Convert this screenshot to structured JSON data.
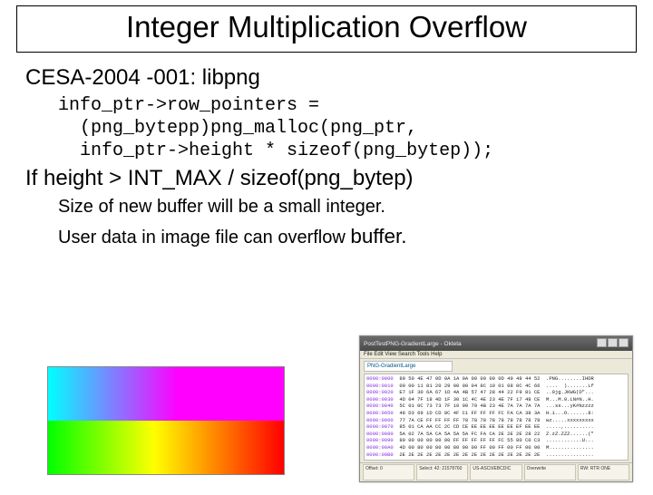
{
  "title": "Integer Multiplication Overflow",
  "advisory": "CESA-2004 -001: libpng",
  "code": "info_ptr->row_pointers =\n  (png_bytepp)png_malloc(png_ptr,\n  info_ptr->height * sizeof(png_bytep));",
  "condition": "If height > INT_MAX / sizeof(png_bytep)",
  "consequence_1": "Size of new buffer will be a small integer.",
  "consequence_2_a": "User data in image file can overflow ",
  "consequence_2_b": "buffer.",
  "hexview": {
    "window_title": "PostTestPNG-GradientLarge - Okteta",
    "menu": "File  Edit  View  Search  Tools  Help",
    "tab": "PNG-GradientLarge",
    "lines": [
      {
        "addr": "0000:0000",
        "hex": "89 50 4E 47 0D 0A 1A 0A 00 00 00 0D 49 48 44 52",
        "asc": ".PNG........IHDR"
      },
      {
        "addr": "0000:0010",
        "hex": "00 00 11 81 20 29 00 00 04 8C 10 01 08 0C 4C 66",
        "asc": "....  ).......Lf"
      },
      {
        "addr": "0000:0020",
        "hex": "E7 1F 30 6A 67 1D 4A 4B 57 47 28 44 22 F9 81 CE",
        "asc": "..0jg.JKWG(D\"..."
      },
      {
        "addr": "0000:0030",
        "hex": "4D 04 7F 18 4D 1F 30 1C 4C 4E 23 4E 7F 17 48 CE",
        "asc": "M...M.0.LN#N..H."
      },
      {
        "addr": "0000:0040",
        "hex": "5C 01 0C 73 73 7F 10 00 79 4B 23 4E 7A 7A 7A 7A",
        "asc": "...ss...yK#Nzzzz"
      },
      {
        "addr": "0000:0050",
        "hex": "48 D3 69 1D CD 8C 4F C1 FF FF FF FC FA CA 38 3A",
        "asc": "H.i...O.......8:"
      },
      {
        "addr": "0000:0060",
        "hex": "77 7A CE FF FF FF FF 78 78 78 78 78 78 78 78 78",
        "asc": "wz.....xxxxxxxxx"
      },
      {
        "addr": "0000:0070",
        "hex": "85 01 CA AA CC 2C CD CE EE EE EE EE EE EF EE EE",
        "asc": ".....,.........."
      },
      {
        "addr": "0000:0080",
        "hex": "5A 02 7A 5A CA 5A 5A 5A FC FA CA 2E 2E 2E 28 22",
        "asc": "Z.zZ.ZZZ......(\""
      },
      {
        "addr": "0000:0090",
        "hex": "80 00 00 00 00 00 FF FF FF FF FF FC 55 80 C0 C3",
        "asc": "............U..."
      },
      {
        "addr": "0000:00A0",
        "hex": "4D 00 80 00 80 00 80 00 00 FF 00 FF 00 FF 00 00",
        "asc": "M..............."
      },
      {
        "addr": "0000:00B0",
        "hex": "2E 2E 2E 2E 2E 2E 2E 2E 2E 2E 2E 2E 2E 2E 2E 2E",
        "asc": "................"
      }
    ],
    "status": {
      "offset_label": "Offset: 0",
      "selection": "Select: 42: 21578760",
      "encoding": "US-ASCII/EBCDIC",
      "mode": "Overwrite",
      "rw": "RW: RTR ONE"
    }
  }
}
